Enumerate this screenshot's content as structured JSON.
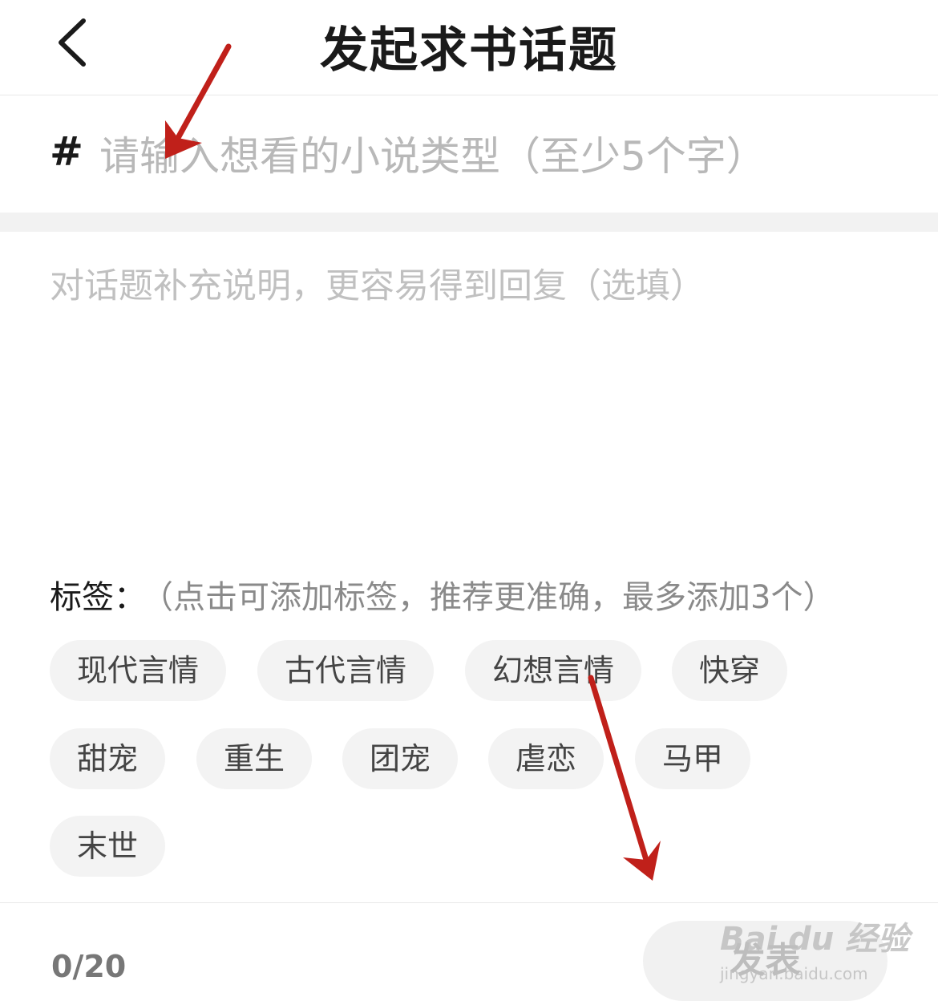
{
  "header": {
    "back_icon": "chevron-left-icon",
    "title": "发起求书话题"
  },
  "topic": {
    "hash_symbol": "#",
    "placeholder": "请输入想看的小说类型（至少5个字）",
    "value": ""
  },
  "description": {
    "placeholder": "对话题补充说明，更容易得到回复（选填）",
    "value": ""
  },
  "tags": {
    "label": "标签：",
    "hint": "（点击可添加标签，推荐更准确，最多添加3个）",
    "items": [
      "现代言情",
      "古代言情",
      "幻想言情",
      "快穿",
      "甜宠",
      "重生",
      "团宠",
      "虐恋",
      "马甲",
      "末世"
    ]
  },
  "footer": {
    "counter": "0/20",
    "publish_label": "发表"
  },
  "watermark": {
    "logo": "Bai du 经验",
    "url": "jingyan.baidu.com"
  },
  "colors": {
    "annotation_arrow": "#c0201a",
    "chip_bg": "#f3f3f3",
    "placeholder": "#b8b8b8"
  }
}
